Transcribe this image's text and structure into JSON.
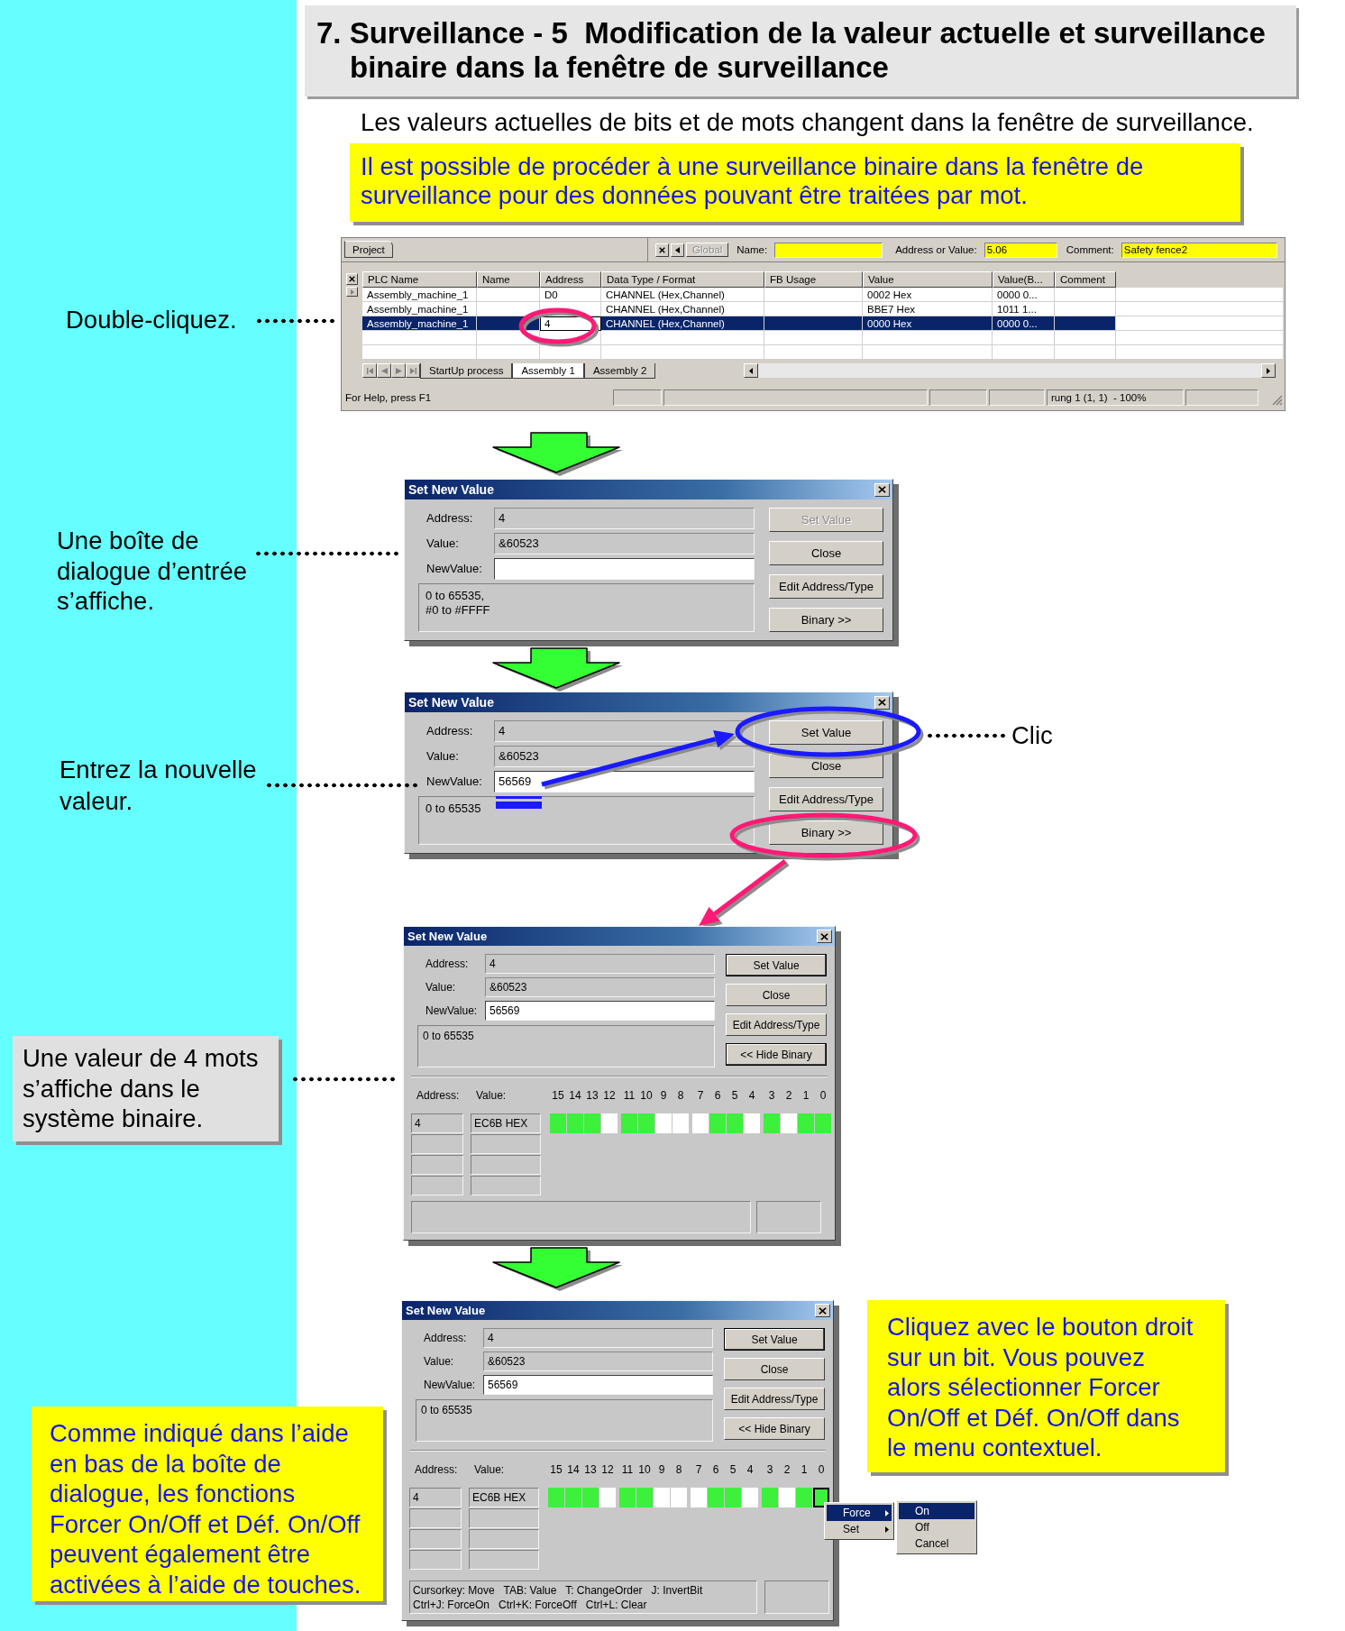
{
  "heading": "7. Surveillance - 5  Modification de la valeur actuelle et surveillance binaire dans la fenêtre de surveillance",
  "intro": "Les valeurs actuelles de bits et de mots changent dans la fenêtre de surveillance.",
  "note": {
    "kind": "yellow",
    "lines": [
      "Il est possible de procéder à une surveillance binaire dans la fenêtre de",
      "surveillance pour des données pouvant être traitées par mot."
    ]
  },
  "project_window": {
    "callout": {
      "kind": "plain",
      "lines": [
        "Double-cliquez."
      ]
    },
    "tab": "Project",
    "global_button": {
      "label": "Global",
      "disabled": true
    },
    "fields": [
      {
        "label": "Name:"
      },
      {
        "label": "Address or Value:",
        "value": "5.06"
      },
      {
        "label": "Comment:",
        "value": "Safety fence2"
      }
    ],
    "table": {
      "columns": [
        "PLC Name",
        "Name",
        "Address",
        "Data Type / Format",
        "FB Usage",
        "Value",
        "Value(B...",
        "Comment"
      ],
      "rows": [
        {
          "plc_name": "Assembly_machine_1",
          "address": "D0",
          "data_type": "CHANNEL (Hex,Channel)",
          "value": "0002 Hex",
          "value_b": "0000 0...",
          "selected": false,
          "editing": false
        },
        {
          "plc_name": "Assembly_machine_1",
          "data_type": "CHANNEL (Hex,Channel)",
          "value": "BBE7 Hex",
          "value_b": "1011 1...",
          "selected": false,
          "editing": false
        },
        {
          "plc_name": "Assembly_machine_1",
          "address": "4",
          "data_type": "CHANNEL (Hex,Channel)",
          "value": "0000 Hex",
          "value_b": "0000 0...",
          "selected": true,
          "editing": true
        }
      ]
    },
    "sheet_tabs": [
      {
        "label": "StartUp process",
        "selected": false
      },
      {
        "label": "Assembly 1",
        "selected": true
      },
      {
        "label": "Assembly 2",
        "selected": false
      }
    ],
    "status_bar": {
      "help": "For Help, press F1",
      "position": "rung 1 (1, 1)  - 100%"
    }
  },
  "dialogs": [
    {
      "callouts": [
        {
          "kind": "plain",
          "lines": [
            "Une boîte de",
            "dialogue d’entrée",
            "s’affiche."
          ]
        }
      ],
      "title": "Set New Value",
      "fields": [
        {
          "label": "Address:",
          "value": "4",
          "editable": false
        },
        {
          "label": "Value:",
          "value": "&60523",
          "editable": false
        },
        {
          "label": "NewValue:",
          "editable": true
        }
      ],
      "range": [
        "0 to 65535,",
        "#0 to #FFFF"
      ],
      "buttons": [
        {
          "label": "Set Value",
          "disabled": true,
          "default": false
        },
        {
          "label": "Close",
          "disabled": false,
          "default": false
        },
        {
          "label": "Edit Address/Type",
          "disabled": false,
          "default": false
        },
        {
          "label": "Binary >>",
          "disabled": false,
          "default": false
        }
      ]
    },
    {
      "callouts": [
        {
          "kind": "plain",
          "lines": [
            "Entrez la nouvelle",
            "valeur."
          ]
        },
        {
          "kind": "plain",
          "lines": [
            "Clic"
          ]
        }
      ],
      "title": "Set New Value",
      "fields": [
        {
          "label": "Address:",
          "value": "4",
          "editable": false
        },
        {
          "label": "Value:",
          "value": "&60523",
          "editable": false
        },
        {
          "label": "NewValue:",
          "value": "56569",
          "editable": true
        }
      ],
      "range": [
        "0 to 65535"
      ],
      "buttons": [
        {
          "label": "Set Value",
          "disabled": false,
          "default": false
        },
        {
          "label": "Close",
          "disabled": false,
          "default": false
        },
        {
          "label": "Edit Address/Type",
          "disabled": false,
          "default": false
        },
        {
          "label": "Binary >>",
          "disabled": false,
          "default": false
        }
      ]
    },
    {
      "callouts": [
        {
          "kind": "gray",
          "lines": [
            "Une valeur de 4 mots",
            "s’affiche dans le",
            "système binaire."
          ]
        }
      ],
      "title": "Set New Value",
      "fields": [
        {
          "label": "Address:",
          "value": "4",
          "editable": false
        },
        {
          "label": "Value:",
          "value": "&60523",
          "editable": false
        },
        {
          "label": "NewValue:",
          "value": "56569",
          "editable": true
        }
      ],
      "range": [
        "0 to 65535"
      ],
      "buttons": [
        {
          "label": "Set Value",
          "disabled": false,
          "default": true
        },
        {
          "label": "Close",
          "disabled": false,
          "default": false
        },
        {
          "label": "Edit Address/Type",
          "disabled": false,
          "default": false
        },
        {
          "label": "<< Hide Binary",
          "disabled": false,
          "default": true
        }
      ],
      "binary": {
        "headers": [
          "Address:",
          "Value:"
        ],
        "rows": [
          {
            "address": "4",
            "value": "EC6B HEX"
          }
        ],
        "bits": [
          {
            "label": "15",
            "on": true,
            "selected": false
          },
          {
            "label": "14",
            "on": true,
            "selected": false
          },
          {
            "label": "13",
            "on": true,
            "selected": false
          },
          {
            "label": "12",
            "on": false,
            "selected": false
          },
          {
            "label": "11",
            "on": true,
            "selected": false
          },
          {
            "label": "10",
            "on": true,
            "selected": false
          },
          {
            "label": "9",
            "on": false,
            "selected": false
          },
          {
            "label": "8",
            "on": false,
            "selected": false
          },
          {
            "label": "7",
            "on": false,
            "selected": false
          },
          {
            "label": "6",
            "on": true,
            "selected": false
          },
          {
            "label": "5",
            "on": true,
            "selected": false
          },
          {
            "label": "4",
            "on": false,
            "selected": false
          },
          {
            "label": "3",
            "on": true,
            "selected": false
          },
          {
            "label": "2",
            "on": false,
            "selected": false
          },
          {
            "label": "1",
            "on": true,
            "selected": false
          },
          {
            "label": "0",
            "on": true,
            "selected": false
          }
        ]
      }
    },
    {
      "callouts": [
        {
          "kind": "yellow",
          "lines": [
            "Comme indiqué dans l’aide",
            "en bas de la boîte de",
            "dialogue, les fonctions",
            "Forcer On/Off et Déf. On/Off",
            "peuvent également être",
            "activées à l’aide de touches."
          ]
        },
        {
          "kind": "yellow",
          "lines": [
            "Cliquez avec le bouton droit",
            "sur un bit. Vous pouvez",
            "alors sélectionner Forcer",
            "On/Off et Déf. On/Off dans",
            "le menu contextuel."
          ]
        }
      ],
      "title": "Set New Value",
      "fields": [
        {
          "label": "Address:",
          "value": "4",
          "editable": false
        },
        {
          "label": "Value:",
          "value": "&60523",
          "editable": false
        },
        {
          "label": "NewValue:",
          "value": "56569",
          "editable": true
        }
      ],
      "range": [
        "0 to 65535"
      ],
      "buttons": [
        {
          "label": "Set Value",
          "disabled": false,
          "default": true
        },
        {
          "label": "Close",
          "disabled": false,
          "default": false
        },
        {
          "label": "Edit Address/Type",
          "disabled": false,
          "default": false
        },
        {
          "label": "<< Hide Binary",
          "disabled": false,
          "default": false
        }
      ],
      "binary": {
        "headers": [
          "Address:",
          "Value:"
        ],
        "rows": [
          {
            "address": "4",
            "value": "EC6B HEX"
          }
        ],
        "bits": [
          {
            "label": "15",
            "on": true,
            "selected": false
          },
          {
            "label": "14",
            "on": true,
            "selected": false
          },
          {
            "label": "13",
            "on": true,
            "selected": false
          },
          {
            "label": "12",
            "on": false,
            "selected": false
          },
          {
            "label": "11",
            "on": true,
            "selected": false
          },
          {
            "label": "10",
            "on": true,
            "selected": false
          },
          {
            "label": "9",
            "on": false,
            "selected": false
          },
          {
            "label": "8",
            "on": false,
            "selected": false
          },
          {
            "label": "7",
            "on": false,
            "selected": false
          },
          {
            "label": "6",
            "on": true,
            "selected": false
          },
          {
            "label": "5",
            "on": true,
            "selected": false
          },
          {
            "label": "4",
            "on": false,
            "selected": false
          },
          {
            "label": "3",
            "on": true,
            "selected": false
          },
          {
            "label": "2",
            "on": false,
            "selected": false
          },
          {
            "label": "1",
            "on": true,
            "selected": false
          },
          {
            "label": "0",
            "on": true,
            "selected": true
          }
        ],
        "help": [
          "Cursorkey: Move   TAB: Value   T: ChangeOrder   J: InvertBit",
          "Ctrl+J: ForceOn   Ctrl+K: ForceOff   Ctrl+L: Clear"
        ]
      },
      "context_menu": {
        "items": [
          {
            "label": "Force",
            "selected": true,
            "submenu": true
          },
          {
            "label": "Set",
            "selected": false,
            "submenu": true
          }
        ],
        "submenu": [
          {
            "label": "On",
            "selected": true
          },
          {
            "label": "Off",
            "selected": false
          },
          {
            "label": "Cancel",
            "selected": false
          }
        ]
      }
    }
  ]
}
